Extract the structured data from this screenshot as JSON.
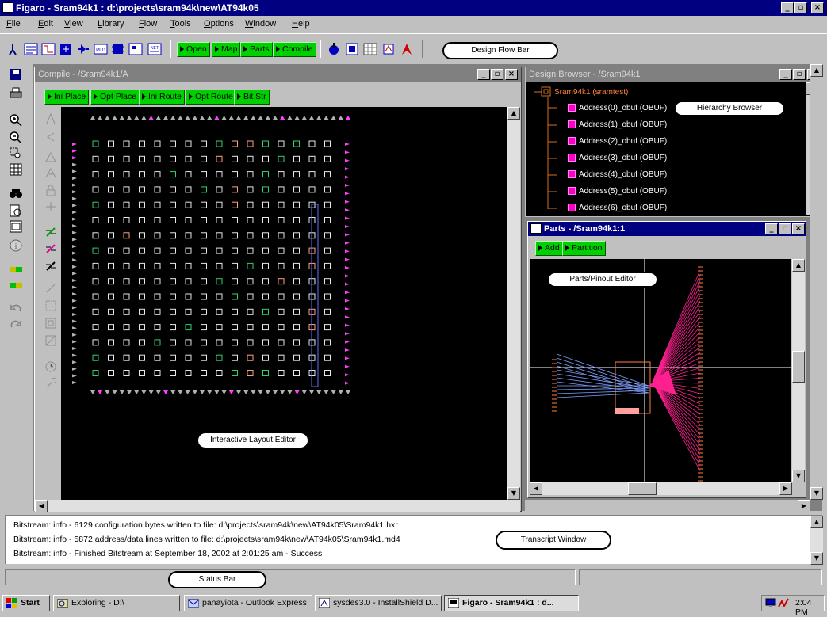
{
  "app": {
    "title": "Figaro - Sram94k1 : d:\\projects\\sram94k\\new\\AT94k05",
    "title_bar_color": "#000080"
  },
  "menu": [
    "File",
    "Edit",
    "View",
    "Library",
    "Flow",
    "Tools",
    "Options",
    "Window",
    "Help"
  ],
  "toolbar": {
    "flow_buttons": [
      "Open",
      "Map",
      "Parts",
      "Compile"
    ],
    "flow_button_color": "#00d000",
    "callout": "Design Flow Bar"
  },
  "compile_window": {
    "title": "Compile - /Sram94k1/A",
    "buttons": [
      "Ini Place",
      "Opt Place",
      "Ini Route",
      "Opt Route",
      "Bit Str"
    ],
    "callout": "Interactive Layout Editor"
  },
  "browser_window": {
    "title": "Design Browser - /Sram94k1",
    "root": "Sram94k1 (sramtest)",
    "items": [
      "Address(0)_obuf (OBUF)",
      "Address(1)_obuf (OBUF)",
      "Address(2)_obuf (OBUF)",
      "Address(3)_obuf (OBUF)",
      "Address(4)_obuf (OBUF)",
      "Address(5)_obuf (OBUF)",
      "Address(6)_obuf (OBUF)"
    ],
    "callout": "Hierarchy Browser"
  },
  "parts_window": {
    "title": "Parts - /Sram94k1:1",
    "buttons": [
      "Add",
      "Partition"
    ],
    "callout": "Parts/Pinout Editor"
  },
  "transcript": {
    "lines": [
      "Bitstream: info - 6129 configuration bytes written to file: d:\\projects\\sram94k\\new\\AT94k05\\Sram94k1.hxr",
      "Bitstream: info - 5872 address/data lines written to file: d:\\projects\\sram94k\\new\\AT94k05\\Sram94k1.md4",
      "Bitstream: info - Finished Bitstream at September 18, 2002 at 2:01:25 am - Success"
    ],
    "callout": "Transcript Window"
  },
  "status": {
    "callout": "Status Bar"
  },
  "taskbar": {
    "start": "Start",
    "tasks": [
      "Exploring - D:\\",
      "panayiota - Outlook Express",
      "sysdes3.0 - InstallShield D...",
      "Figaro - Sram94k1 : d..."
    ],
    "clock": "2:04 PM"
  }
}
